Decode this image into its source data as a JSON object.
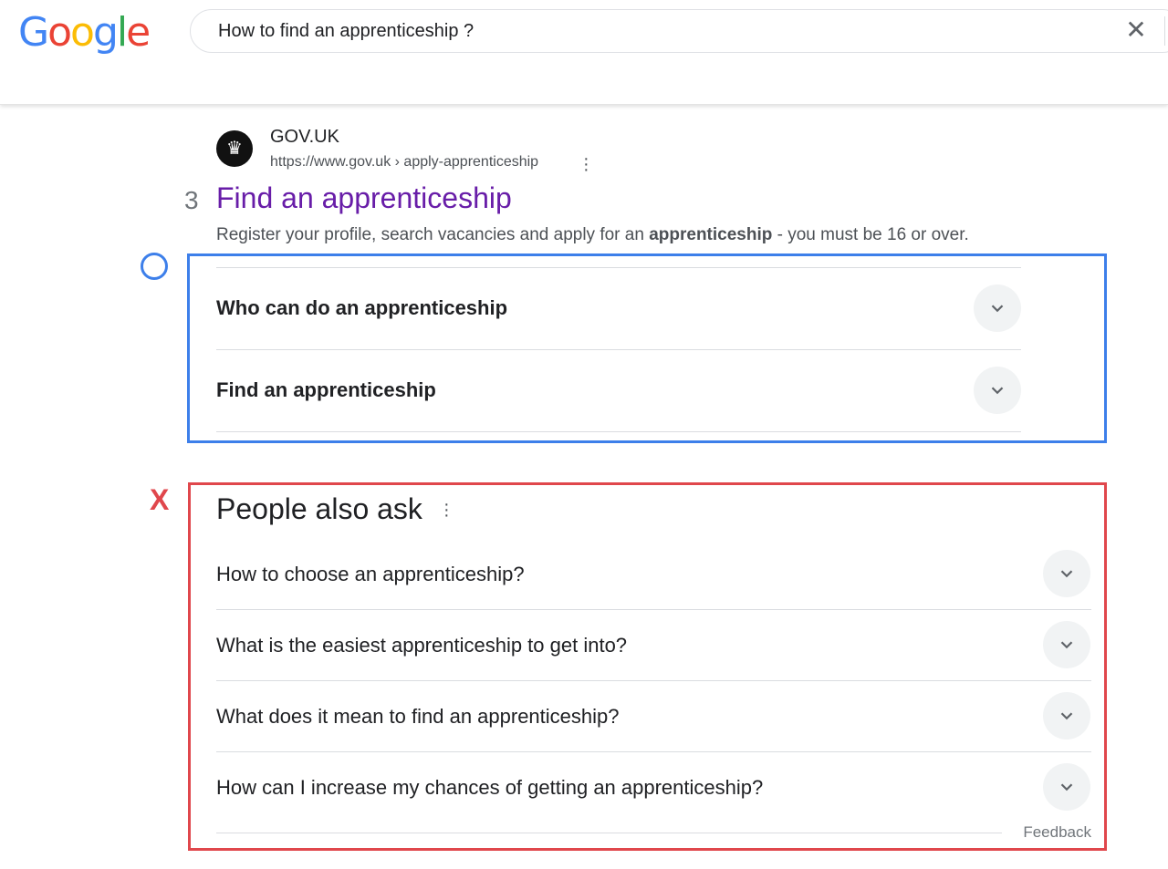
{
  "header": {
    "logo": "Google",
    "query": "How to find an apprenticeship ?",
    "clear_icon": "close-icon"
  },
  "result": {
    "site_name": "GOV.UK",
    "url": "https://www.gov.uk › apply-apprenticeship",
    "number": "3",
    "title": "Find an apprenticeship",
    "snippet_pre": "Register your profile, search vacancies and apply for an ",
    "snippet_bold": "apprenticeship",
    "snippet_post": " - you must be 16 or over.",
    "sitelinks": [
      {
        "label": "Who can do an apprenticeship"
      },
      {
        "label": "Find an apprenticeship"
      }
    ]
  },
  "annotations": {
    "good_mark": "O",
    "bad_mark": "X",
    "good_color": "#3d7fea",
    "bad_color": "#e0474c"
  },
  "paa": {
    "title": "People also ask",
    "questions": [
      {
        "label": "How to choose an apprenticeship?"
      },
      {
        "label": "What is the easiest apprenticeship to get into?"
      },
      {
        "label": "What does it mean to find an apprenticeship?"
      },
      {
        "label": "How can I increase my chances of getting an apprenticeship?"
      }
    ],
    "feedback": "Feedback"
  }
}
